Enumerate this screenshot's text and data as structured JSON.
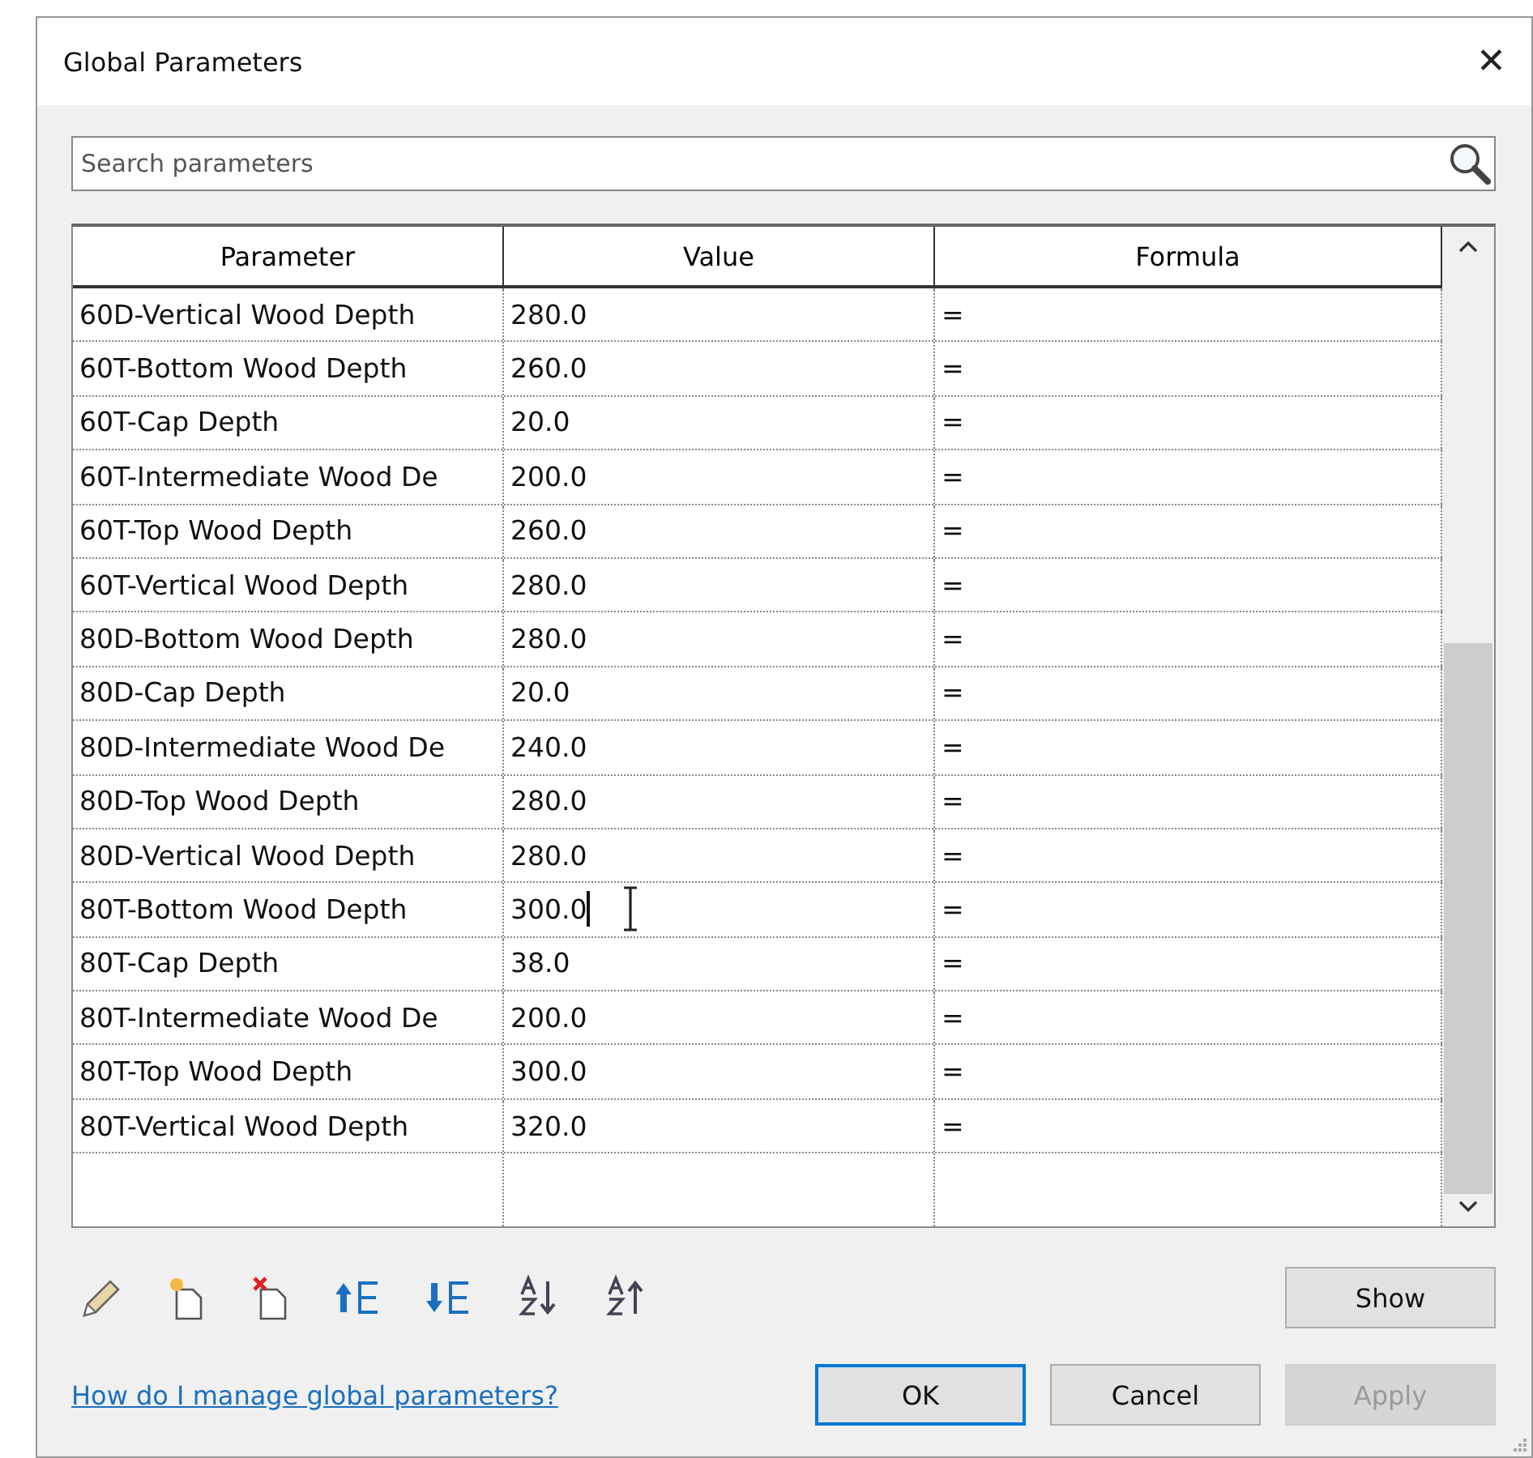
{
  "window": {
    "title": "Global Parameters",
    "close": "✕"
  },
  "search": {
    "placeholder": "Search parameters"
  },
  "table": {
    "columns": [
      "Parameter",
      "Value",
      "Formula"
    ],
    "rows": [
      {
        "parameter": "60D-Vertical Wood Depth",
        "value": "280.0",
        "formula": "=",
        "editing": false
      },
      {
        "parameter": "60T-Bottom Wood Depth",
        "value": "260.0",
        "formula": "=",
        "editing": false
      },
      {
        "parameter": "60T-Cap Depth",
        "value": "20.0",
        "formula": "=",
        "editing": false
      },
      {
        "parameter": "60T-Intermediate Wood De",
        "value": "200.0",
        "formula": "=",
        "editing": false
      },
      {
        "parameter": "60T-Top Wood Depth",
        "value": "260.0",
        "formula": "=",
        "editing": false
      },
      {
        "parameter": "60T-Vertical Wood Depth",
        "value": "280.0",
        "formula": "=",
        "editing": false
      },
      {
        "parameter": "80D-Bottom Wood Depth",
        "value": "280.0",
        "formula": "=",
        "editing": false
      },
      {
        "parameter": "80D-Cap Depth",
        "value": "20.0",
        "formula": "=",
        "editing": false
      },
      {
        "parameter": "80D-Intermediate Wood De",
        "value": "240.0",
        "formula": "=",
        "editing": false
      },
      {
        "parameter": "80D-Top Wood Depth",
        "value": "280.0",
        "formula": "=",
        "editing": false
      },
      {
        "parameter": "80D-Vertical Wood Depth",
        "value": "280.0",
        "formula": "=",
        "editing": false
      },
      {
        "parameter": "80T-Bottom Wood Depth",
        "value": "300.0",
        "formula": "=",
        "editing": true
      },
      {
        "parameter": "80T-Cap Depth",
        "value": "38.0",
        "formula": "=",
        "editing": false
      },
      {
        "parameter": "80T-Intermediate Wood De",
        "value": "200.0",
        "formula": "=",
        "editing": false
      },
      {
        "parameter": "80T-Top Wood Depth",
        "value": "300.0",
        "formula": "=",
        "editing": false
      },
      {
        "parameter": "80T-Vertical Wood Depth",
        "value": "320.0",
        "formula": "=",
        "editing": false
      }
    ]
  },
  "help_link": "How do I manage global parameters?",
  "buttons": [
    {
      "label": "Show",
      "kind": "side",
      "disabled": false,
      "default": false
    },
    {
      "label": "OK",
      "kind": "footer",
      "disabled": false,
      "default": true
    },
    {
      "label": "Cancel",
      "kind": "footer",
      "disabled": false,
      "default": false
    },
    {
      "label": "Apply",
      "kind": "footer",
      "disabled": true,
      "default": false
    }
  ]
}
